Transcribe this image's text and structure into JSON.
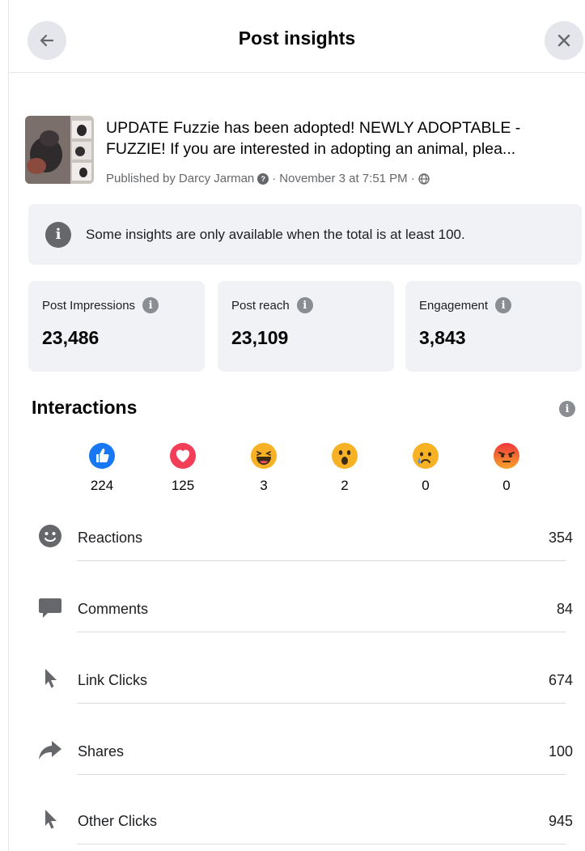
{
  "header": {
    "title": "Post insights",
    "back_icon": "arrow-left-icon",
    "close_icon": "close-icon"
  },
  "post": {
    "text_line1": "UPDATE Fuzzie has been adopted! NEWLY ADOPTABLE -",
    "text_line2": "FUZZIE! If you are interested in adopting an animal, plea...",
    "published_prefix": "Published by",
    "author": "Darcy Jarman",
    "date": "November 3 at 7:51 PM"
  },
  "notice": {
    "text": "Some insights are only available when the total is at least 100."
  },
  "stats": [
    {
      "label": "Post Impressions",
      "value": "23,486"
    },
    {
      "label": "Post reach",
      "value": "23,109"
    },
    {
      "label": "Engagement",
      "value": "3,843"
    }
  ],
  "interactions": {
    "title": "Interactions",
    "reactions": [
      {
        "name": "like",
        "count": "224",
        "color": "#1877f2"
      },
      {
        "name": "love",
        "count": "125",
        "color": "#f33e58"
      },
      {
        "name": "haha",
        "count": "3",
        "color": "#f7b125"
      },
      {
        "name": "wow",
        "count": "2",
        "color": "#f7b125"
      },
      {
        "name": "sad",
        "count": "0",
        "color": "#f7b125"
      },
      {
        "name": "angry",
        "count": "0",
        "color": "#e9710f"
      }
    ],
    "metrics": [
      {
        "label": "Reactions",
        "value": "354",
        "icon": "smiley-icon"
      },
      {
        "label": "Comments",
        "value": "84",
        "icon": "comment-icon"
      },
      {
        "label": "Link Clicks",
        "value": "674",
        "icon": "cursor-icon"
      },
      {
        "label": "Shares",
        "value": "100",
        "icon": "share-arrow-icon"
      },
      {
        "label": "Other Clicks",
        "value": "945",
        "icon": "cursor-icon"
      }
    ]
  },
  "colors": {
    "card_background": "#f0f2f5",
    "icon_gray": "#65676b",
    "text": "#050505",
    "like_blue": "#1877f2"
  }
}
